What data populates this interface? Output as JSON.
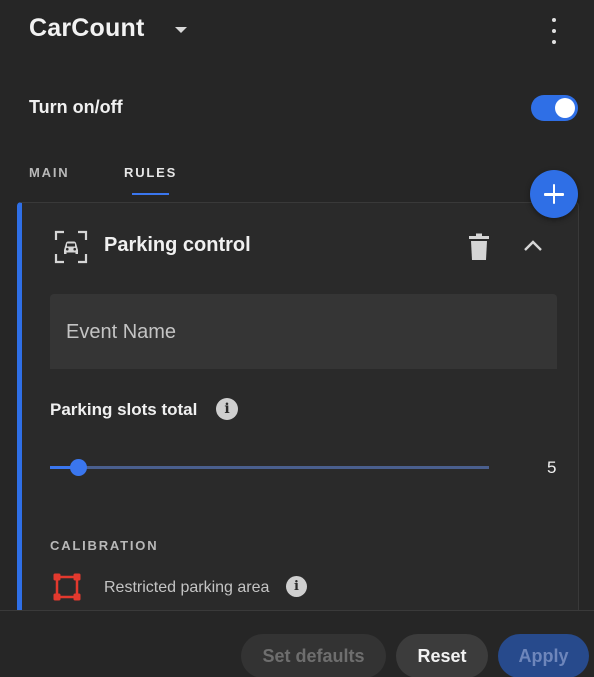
{
  "header": {
    "app_title": "CarCount",
    "menu_icon": "kebab-menu-icon",
    "dropdown_icon": "caret-down-icon"
  },
  "power": {
    "label": "Turn on/off",
    "enabled": true
  },
  "tabs": [
    {
      "label": "MAIN",
      "active": false
    },
    {
      "label": "RULES",
      "active": true
    }
  ],
  "add_button_icon": "plus-icon",
  "rule": {
    "title": "Parking control",
    "icon": "car-scan-icon",
    "delete_icon": "trash-icon",
    "collapse_icon": "chevron-up-icon",
    "event_name": {
      "placeholder": "Event Name",
      "value": ""
    },
    "slots": {
      "label": "Parking slots total",
      "value": "5",
      "min": 0,
      "max": 100
    },
    "calibration": {
      "heading": "CALIBRATION",
      "area_label": "Restricted parking area",
      "area_icon": "polygon-area-icon"
    }
  },
  "footer": {
    "set_defaults": "Set defaults",
    "reset": "Reset",
    "apply": "Apply"
  },
  "colors": {
    "accent": "#2f6fe6",
    "background": "#262626",
    "card": "#2a2a2a",
    "area_icon": "#e2392e"
  }
}
